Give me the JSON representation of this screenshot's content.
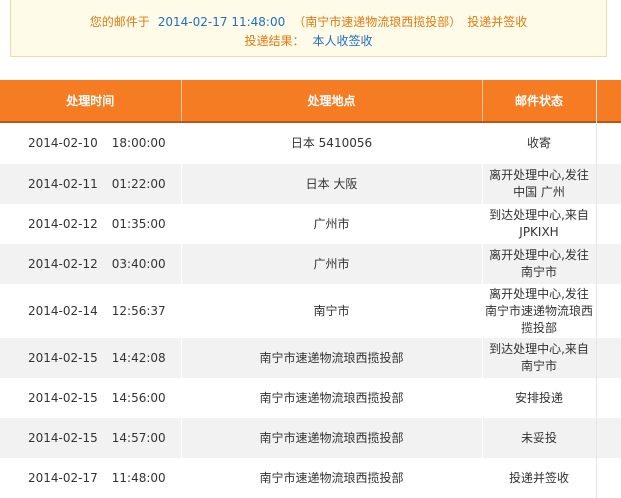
{
  "summary": {
    "prefix": "您的邮件于",
    "datetime": "2014-02-17 11:48:00",
    "office": "（南宁市速递物流琅西揽投部）",
    "status": "投递并签收",
    "result_label": "投递结果：",
    "result_value": "本人收签收"
  },
  "table": {
    "headers": [
      "处理时间",
      "处理地点",
      "邮件状态"
    ],
    "rows": [
      {
        "date": "2014-02-10",
        "time": "18:00:00",
        "location": "日本 5410056",
        "status": "收寄"
      },
      {
        "date": "2014-02-11",
        "time": "01:22:00",
        "location": "日本 大阪",
        "status": "离开处理中心,发往中国 广州"
      },
      {
        "date": "2014-02-12",
        "time": "01:35:00",
        "location": "广州市",
        "status": "到达处理中心,来自JPKIXH"
      },
      {
        "date": "2014-02-12",
        "time": "03:40:00",
        "location": "广州市",
        "status": "离开处理中心,发往南宁市"
      },
      {
        "date": "2014-02-14",
        "time": "12:56:37",
        "location": "南宁市",
        "status": "离开处理中心,发往南宁市速递物流琅西揽投部"
      },
      {
        "date": "2014-02-15",
        "time": "14:42:08",
        "location": "南宁市速递物流琅西揽投部",
        "status": "到达处理中心,来自南宁市"
      },
      {
        "date": "2014-02-15",
        "time": "14:56:00",
        "location": "南宁市速递物流琅西揽投部",
        "status": "安排投递"
      },
      {
        "date": "2014-02-15",
        "time": "14:57:00",
        "location": "南宁市速递物流琅西揽投部",
        "status": "未妥投"
      },
      {
        "date": "2014-02-17",
        "time": "11:48:00",
        "location": "南宁市速递物流琅西揽投部",
        "status": "投递并签收"
      }
    ]
  },
  "colors": {
    "header_bg": "#f57c22",
    "summary_text": "#e07a12",
    "summary_highlight": "#1f6fc5",
    "summary_bg": "#fefbe9",
    "row_alt": "#f2f2f2"
  }
}
